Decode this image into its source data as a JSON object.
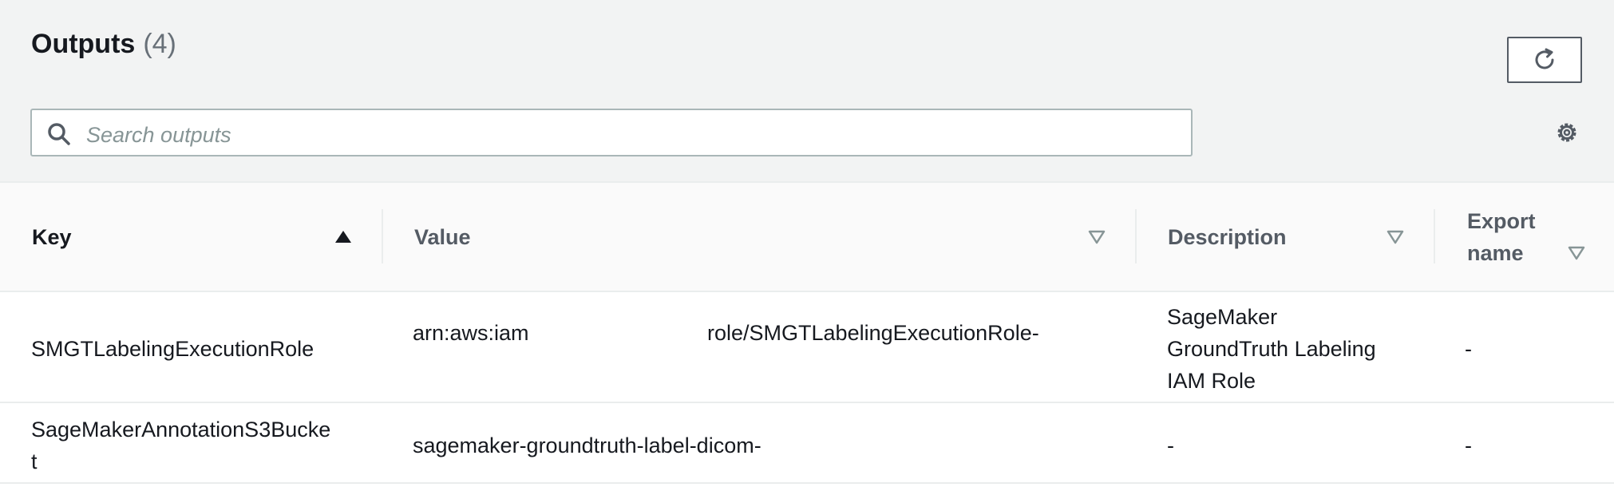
{
  "header": {
    "title": "Outputs",
    "count": "(4)",
    "refresh_icon": "refresh-icon",
    "settings_icon": "gear-icon"
  },
  "search": {
    "placeholder": "Search outputs",
    "icon": "search-icon"
  },
  "table": {
    "columns": [
      {
        "label": "Key",
        "sort": "ascending"
      },
      {
        "label": "Value",
        "sort": "none"
      },
      {
        "label": "Description",
        "sort": "none"
      },
      {
        "label_line1": "Export",
        "label_line2": "name",
        "sort": "none"
      }
    ],
    "rows": [
      {
        "key": "SMGTLabelingExecutionRole",
        "value_part1": "arn:aws:iam",
        "value_part2": "role/SMGTLabelingExecutionRole-",
        "description": [
          "SageMaker",
          "GroundTruth Labeling",
          "IAM Role"
        ],
        "export_name": "-"
      },
      {
        "key": [
          "SageMakerAnnotationS3Bucke",
          "t"
        ],
        "value": "sagemaker-groundtruth-label-dicom-",
        "description": "-",
        "export_name": "-"
      }
    ]
  },
  "colors": {
    "background": "#f2f3f3",
    "header_row": "#fafafa",
    "text": "#16191f",
    "muted_text": "#545b64",
    "placeholder": "#879596",
    "border": "#aab7b8"
  }
}
